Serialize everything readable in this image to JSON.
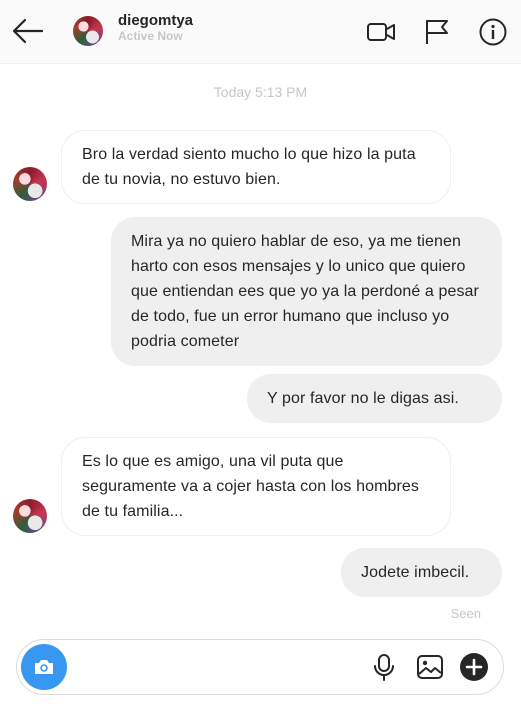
{
  "header": {
    "username": "diegomtya",
    "status": "Active Now",
    "icons": [
      "back-arrow-icon",
      "video-call-icon",
      "flag-icon",
      "info-icon"
    ]
  },
  "conversation": {
    "timestamp": "Today 5:13 PM",
    "messages": [
      {
        "from": "them",
        "text": "Bro la verdad siento mucho lo que hizo la puta de tu novia, no estuvo bien."
      },
      {
        "from": "me",
        "text": "Mira ya no quiero hablar de eso, ya me tienen harto con esos mensajes y lo unico que quiero que entiendan ees que yo ya la perdoné a pesar de todo, fue un error humano que incluso yo podria cometer"
      },
      {
        "from": "me",
        "text": "Y por favor no le digas asi."
      },
      {
        "from": "them",
        "text": "Es lo que es amigo, una vil puta que seguramente va a cojer hasta con los hombres de tu familia..."
      },
      {
        "from": "me",
        "text": "Jodete imbecil."
      }
    ],
    "seen_label": "Seen"
  },
  "composer": {
    "placeholder": "",
    "icons": [
      "camera-icon",
      "microphone-icon",
      "image-icon",
      "plus-icon"
    ]
  },
  "colors": {
    "accent": "#3897f0",
    "outgoing_bubble": "#efefef",
    "muted_text": "#c7c7c7"
  }
}
